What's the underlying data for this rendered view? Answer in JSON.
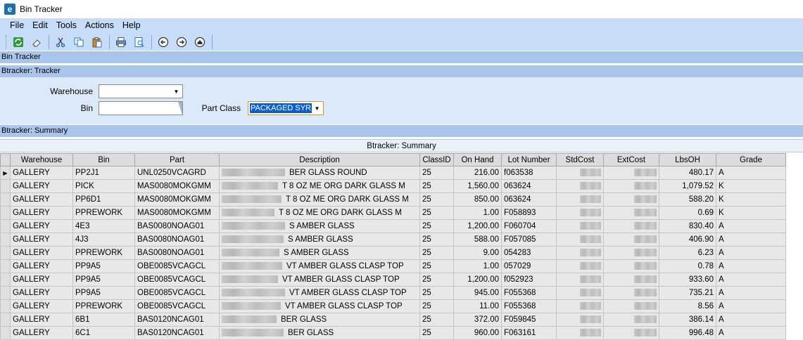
{
  "window": {
    "title": "Bin Tracker",
    "icon": "app-logo-e-icon"
  },
  "menu": [
    "File",
    "Edit",
    "Tools",
    "Actions",
    "Help"
  ],
  "toolbar": {
    "buttons": [
      "refresh-icon",
      "eraser-icon",
      "cut-icon",
      "copy-icon",
      "paste-icon",
      "print-icon",
      "print-preview-icon",
      "back-icon",
      "forward-icon",
      "home-icon"
    ]
  },
  "sections": {
    "bin_tracker": "Bin Tracker",
    "tracker": "Btracker: Tracker",
    "summary": "Btracker: Summary"
  },
  "filters": {
    "warehouse_label": "Warehouse",
    "warehouse_value": "",
    "bin_label": "Bin",
    "bin_value": "",
    "part_class_label": "Part Class",
    "part_class_value": "PACKAGED SYR"
  },
  "grid": {
    "caption": "Btracker: Summary",
    "columns": [
      "Warehouse",
      "Bin",
      "Part",
      "Description",
      "ClassID",
      "On Hand",
      "Lot Number",
      "StdCost",
      "ExtCost",
      "LbsOH",
      "Grade"
    ],
    "rows": [
      {
        "warehouse": "GALLERY",
        "bin": "PP2J1",
        "part": "UNL0250VCAGRD",
        "description": "BER GLASS ROUND",
        "classid": "25",
        "onhand": "216.00",
        "lot": "f063538",
        "lbsoh": "480.17",
        "grade": "A"
      },
      {
        "warehouse": "GALLERY",
        "bin": "PICK",
        "part": "MAS0080MOKGMM",
        "description": "T 8 OZ ME ORG DARK GLASS M",
        "classid": "25",
        "onhand": "1,560.00",
        "lot": "063624",
        "lbsoh": "1,079.52",
        "grade": "K"
      },
      {
        "warehouse": "GALLERY",
        "bin": "PP6D1",
        "part": "MAS0080MOKGMM",
        "description": "T 8 OZ ME ORG DARK GLASS M",
        "classid": "25",
        "onhand": "850.00",
        "lot": "063624",
        "lbsoh": "588.20",
        "grade": "K"
      },
      {
        "warehouse": "GALLERY",
        "bin": "PPREWORK",
        "part": "MAS0080MOKGMM",
        "description": "T 8 OZ ME ORG DARK GLASS M",
        "classid": "25",
        "onhand": "1.00",
        "lot": "F058893",
        "lbsoh": "0.69",
        "grade": "K"
      },
      {
        "warehouse": "GALLERY",
        "bin": "4E3",
        "part": "BAS0080NOAG01",
        "description": "S AMBER GLASS",
        "classid": "25",
        "onhand": "1,200.00",
        "lot": "F060704",
        "lbsoh": "830.40",
        "grade": "A"
      },
      {
        "warehouse": "GALLERY",
        "bin": "4J3",
        "part": "BAS0080NOAG01",
        "description": "S AMBER GLASS",
        "classid": "25",
        "onhand": "588.00",
        "lot": "F057085",
        "lbsoh": "406.90",
        "grade": "A"
      },
      {
        "warehouse": "GALLERY",
        "bin": "PPREWORK",
        "part": "BAS0080NOAG01",
        "description": "S AMBER GLASS",
        "classid": "25",
        "onhand": "9.00",
        "lot": "054283",
        "lbsoh": "6.23",
        "grade": "A"
      },
      {
        "warehouse": "GALLERY",
        "bin": "PP9A5",
        "part": "OBE0085VCAGCL",
        "description": "VT AMBER GLASS CLASP TOP",
        "classid": "25",
        "onhand": "1.00",
        "lot": "057029",
        "lbsoh": "0.78",
        "grade": "A"
      },
      {
        "warehouse": "GALLERY",
        "bin": "PP9A5",
        "part": "OBE0085VCAGCL",
        "description": "VT AMBER GLASS CLASP TOP",
        "classid": "25",
        "onhand": "1,200.00",
        "lot": "f052923",
        "lbsoh": "933.60",
        "grade": "A"
      },
      {
        "warehouse": "GALLERY",
        "bin": "PP9A5",
        "part": "OBE0085VCAGCL",
        "description": "VT AMBER GLASS CLASP TOP",
        "classid": "25",
        "onhand": "945.00",
        "lot": "F055368",
        "lbsoh": "735.21",
        "grade": "A"
      },
      {
        "warehouse": "GALLERY",
        "bin": "PPREWORK",
        "part": "OBE0085VCAGCL",
        "description": "VT AMBER GLASS CLASP TOP",
        "classid": "25",
        "onhand": "11.00",
        "lot": "F055368",
        "lbsoh": "8.56",
        "grade": "A"
      },
      {
        "warehouse": "GALLERY",
        "bin": "6B1",
        "part": "BAS0120NCAG01",
        "description": "BER GLASS",
        "classid": "25",
        "onhand": "372.00",
        "lot": "F059845",
        "lbsoh": "386.14",
        "grade": "A"
      },
      {
        "warehouse": "GALLERY",
        "bin": "6C1",
        "part": "BAS0120NCAG01",
        "description": "BER GLASS",
        "classid": "25",
        "onhand": "960.00",
        "lot": "F063161",
        "lbsoh": "996.48",
        "grade": "A"
      }
    ]
  },
  "colors": {
    "menubar": "#c6dcf8",
    "section_bar": "#a9c5ec",
    "selection": "#0a5ec9"
  }
}
